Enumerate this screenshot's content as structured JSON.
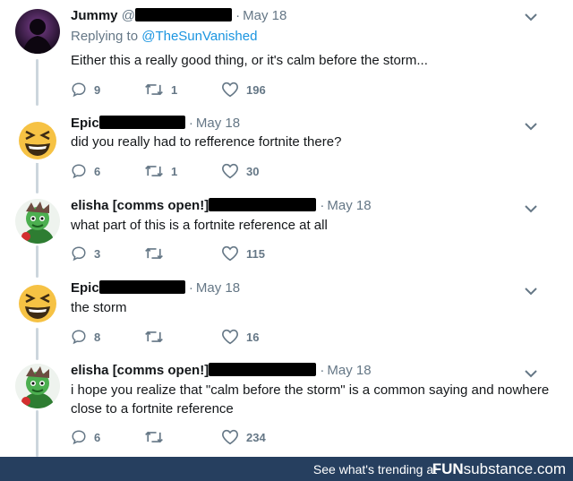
{
  "colors": {
    "link": "#1b95e0",
    "muted": "#657786",
    "thread": "#ccd6dd",
    "footer_bg": "#263f5f"
  },
  "tweets": [
    {
      "name": "Jummy",
      "handle_visible": "@",
      "date": "May 18",
      "reply_prefix": "Replying to ",
      "reply_user": "@TheSunVanished",
      "text": "Either this a really good thing, or it's calm before the storm...",
      "replies": "9",
      "retweets": "1",
      "likes": "196",
      "avatar_icon": "dark-silhouette-avatar"
    },
    {
      "name": "Epic",
      "date": "May 18",
      "text": "did you really had to refference fortnite there?",
      "replies": "6",
      "retweets": "1",
      "likes": "30",
      "avatar_icon": "laughing-emoji-avatar"
    },
    {
      "name": "elisha [comms open!]",
      "date": "May 18",
      "text": "what part of this is a fortnite reference at all",
      "replies": "3",
      "retweets": "",
      "likes": "115",
      "avatar_icon": "green-cartoon-avatar"
    },
    {
      "name": "Epic",
      "date": "May 18",
      "text": "the storm",
      "replies": "8",
      "retweets": "",
      "likes": "16",
      "avatar_icon": "laughing-emoji-avatar"
    },
    {
      "name": "elisha [comms open!]",
      "date": "May 18",
      "text": "i hope you realize that \"calm before the storm\" is a common saying and nowhere close to a fortnite reference",
      "replies": "6",
      "retweets": "",
      "likes": "234",
      "avatar_icon": "green-cartoon-avatar"
    }
  ],
  "footer": {
    "trend_text": "See what's trending at",
    "brand_fun": "FUN",
    "brand_sub": "substance",
    "brand_tld": ".com"
  }
}
